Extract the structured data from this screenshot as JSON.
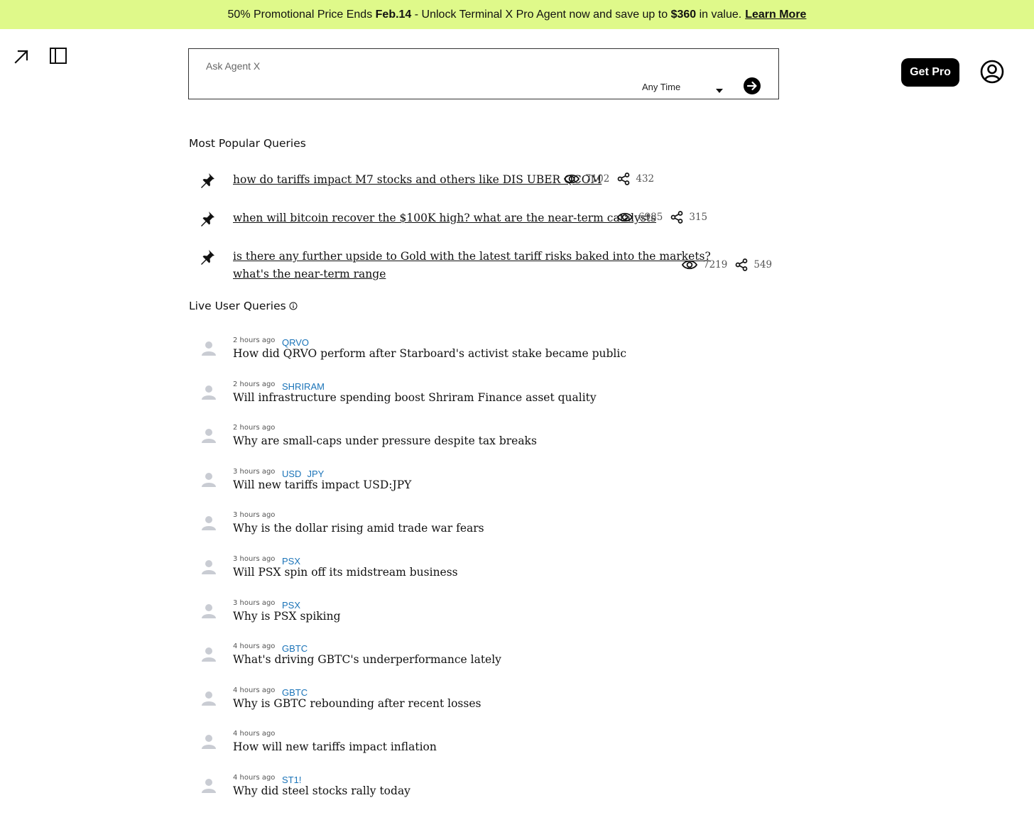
{
  "banner": {
    "part1": "50% Promotional Price Ends ",
    "date": "Feb.14",
    "part2": " - Unlock Terminal X Pro Agent now and save up to ",
    "amount": "$360",
    "part3": " in value.",
    "learn_more": "Learn More",
    "bg_color": "#dff98a"
  },
  "toolbar": {
    "expand_icon": "arrow-up-right-icon",
    "sidebar_icon": "sidebar-toggle-icon"
  },
  "search": {
    "placeholder": "Ask Agent X",
    "value": "",
    "time_filter": "Any Time",
    "submit_icon": "arrow-right-circle-icon"
  },
  "header": {
    "get_pro": "Get Pro",
    "user_icon": "user-circle-icon"
  },
  "popular": {
    "title": "Most Popular Queries",
    "items": [
      {
        "text": "how do tariffs impact M7 stocks and others like DIS UBER QCOM",
        "views": "7102",
        "shares": "432"
      },
      {
        "text": "when will bitcoin recover the $100K high? what are the near-term catalysts",
        "views": "6985",
        "shares": "315"
      },
      {
        "text": "is there any further upside to Gold with the latest tariff risks baked into the markets?",
        "text_line2": "what's the near-term range",
        "views": "7219",
        "shares": "549"
      }
    ]
  },
  "live": {
    "title": "Live User Queries",
    "items": [
      {
        "time": "2 hours ago",
        "tickers": [
          "QRVO"
        ],
        "query": "How did QRVO perform after Starboard's activist stake became public"
      },
      {
        "time": "2 hours ago",
        "tickers": [
          "SHRIRAM"
        ],
        "query": "Will infrastructure spending boost Shriram Finance asset quality"
      },
      {
        "time": "2 hours ago",
        "tickers": [],
        "query": "Why are small-caps under pressure despite tax breaks"
      },
      {
        "time": "3 hours ago",
        "tickers": [
          "USD",
          "JPY"
        ],
        "query": "Will new tariffs impact USD:JPY"
      },
      {
        "time": "3 hours ago",
        "tickers": [],
        "query": "Why is the dollar rising amid trade war fears"
      },
      {
        "time": "3 hours ago",
        "tickers": [
          "PSX"
        ],
        "query": "Will PSX spin off its midstream business"
      },
      {
        "time": "3 hours ago",
        "tickers": [
          "PSX"
        ],
        "query": "Why is PSX spiking"
      },
      {
        "time": "4 hours ago",
        "tickers": [
          "GBTC"
        ],
        "query": "What's driving GBTC's underperformance lately"
      },
      {
        "time": "4 hours ago",
        "tickers": [
          "GBTC"
        ],
        "query": "Why is GBTC rebounding after recent losses"
      },
      {
        "time": "4 hours ago",
        "tickers": [],
        "query": "How will new tariffs impact inflation"
      },
      {
        "time": "4 hours ago",
        "tickers": [
          "ST1!"
        ],
        "query": "Why did steel stocks rally today"
      }
    ]
  }
}
